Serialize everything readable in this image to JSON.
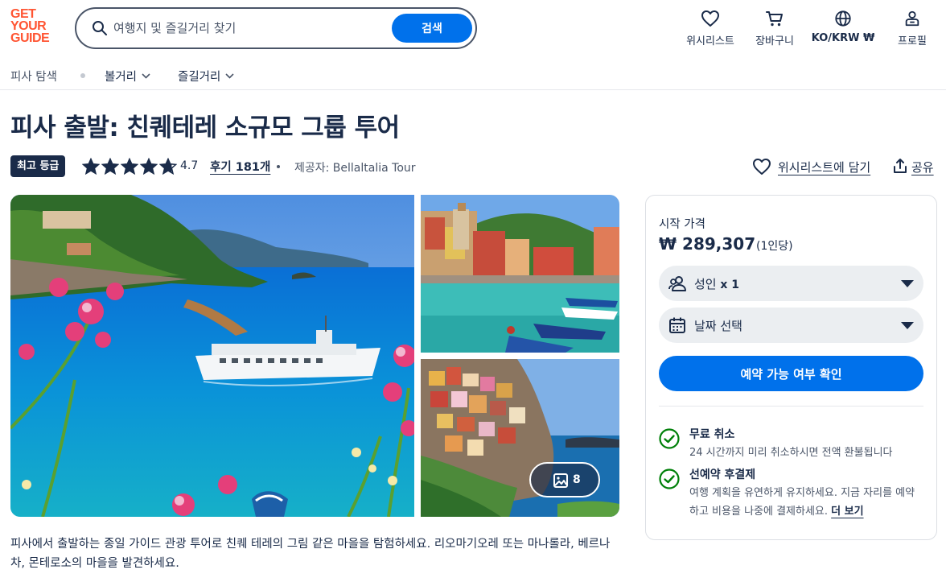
{
  "brand": {
    "logo_lines": [
      "GET",
      "YOUR",
      "GUIDE"
    ],
    "color": "#ff5533"
  },
  "search": {
    "placeholder": "여행지 및 즐길거리 찾기",
    "button_label": "검색"
  },
  "header_nav": {
    "wishlist": "위시리스트",
    "cart": "장바구니",
    "language": "KO/KRW ₩",
    "profile": "프로필"
  },
  "subnav": {
    "explore": "피사 탐색",
    "sights": "볼거리",
    "fun": "즐길거리"
  },
  "activity": {
    "title": "피사 출발: 친퀘테레 소규모 그룹 투어",
    "badge": "최고 등급",
    "rating": "4.7",
    "rating_value": 4.7,
    "reviews": "후기 181개",
    "provider": "제공자: Bellaltalia Tour",
    "wishlist_add": "위시리스트에 담기",
    "share": "공유",
    "description": "피사에서 출발하는 종일 가이드 관광 투어로 친퀘 테레의 그림 같은 마을을 탐험하세요. 리오마기오레 또는 마나롤라, 베르나차, 몬테로소의 마을을 발견하세요."
  },
  "gallery": {
    "photo_count": "8"
  },
  "booking": {
    "price_label": "시작 가격",
    "price": "₩ 289,307",
    "price_unit": "(1인당)",
    "people_label": "성인",
    "people_count": "x 1",
    "date_label": "날짜 선택",
    "check_button": "예약 가능 여부 확인",
    "free_cancel_title": "무료 취소",
    "free_cancel_desc": "24 시간까지 미리 취소하시면 전액 환불됩니다",
    "pay_later_title": "선예약 후결제",
    "pay_later_desc": "여행 계획을 유연하게 유지하세요. 지금 자리를 예약하고 비용을 나중에 결제하세요.",
    "more_link": "더 보기"
  },
  "colors": {
    "primary": "#0071eb",
    "text": "#1a2b49",
    "success": "#008009",
    "badge": "#1a2b49"
  },
  "icons": [
    "search-icon",
    "heart-icon",
    "cart-icon",
    "globe-icon",
    "profile-icon",
    "chevron-down-icon",
    "star-icon",
    "share-icon",
    "users-icon",
    "calendar-icon",
    "check-circle-icon",
    "image-icon"
  ]
}
